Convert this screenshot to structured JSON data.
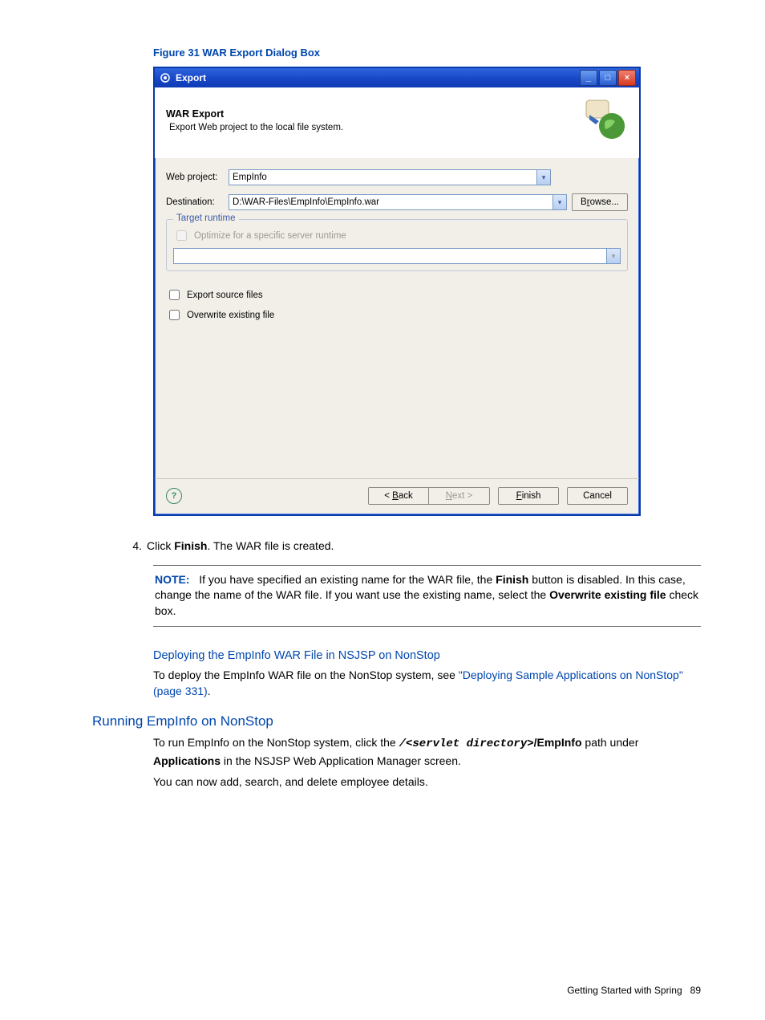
{
  "figure_caption": "Figure 31 WAR Export Dialog Box",
  "dialog": {
    "title": "Export",
    "banner": {
      "heading": "WAR Export",
      "sub": "Export Web project to the local file system."
    },
    "form": {
      "web_project_label": "Web project:",
      "web_project_value": "EmpInfo",
      "destination_label": "Destination:",
      "destination_value": "D:\\WAR-Files\\EmpInfo\\EmpInfo.war",
      "browse_label": "Browse..."
    },
    "group": {
      "legend": "Target runtime",
      "optimize_label": "Optimize for a specific server runtime"
    },
    "checks": {
      "export_src_label": "Export source files",
      "overwrite_label": "Overwrite existing file"
    },
    "buttons": {
      "back": "< Back",
      "next": "Next >",
      "finish": "Finish",
      "cancel": "Cancel"
    }
  },
  "step4": {
    "num": "4.",
    "text_a": "Click ",
    "text_b": "Finish",
    "text_c": ". The WAR file is created."
  },
  "note": {
    "label": "NOTE:",
    "t1": "If you have specified an existing name for the WAR file, the ",
    "b1": "Finish",
    "t2": " button is disabled. In this case, change the name of the WAR file. If you want use the existing name, select the ",
    "b2": "Overwrite existing file",
    "t3": " check box."
  },
  "sec_deploy": {
    "heading": "Deploying the EmpInfo WAR File in NSJSP on NonStop",
    "p_a": "To deploy the EmpInfo WAR file on the NonStop system, see ",
    "link": "\"Deploying Sample Applications on NonStop\" (page 331)",
    "p_b": "."
  },
  "sec_run": {
    "heading": "Running EmpInfo on NonStop",
    "p1_a": "To run EmpInfo on the NonStop system, click the ",
    "code": "/<servlet directory>",
    "p1_b": "/EmpInfo",
    "p1_c": " path under ",
    "p1_d": "Applications",
    "p1_e": " in the NSJSP Web Application Manager screen.",
    "p2": "You can now add, search, and delete employee details."
  },
  "footer": {
    "text": "Getting Started with Spring",
    "page": "89"
  }
}
